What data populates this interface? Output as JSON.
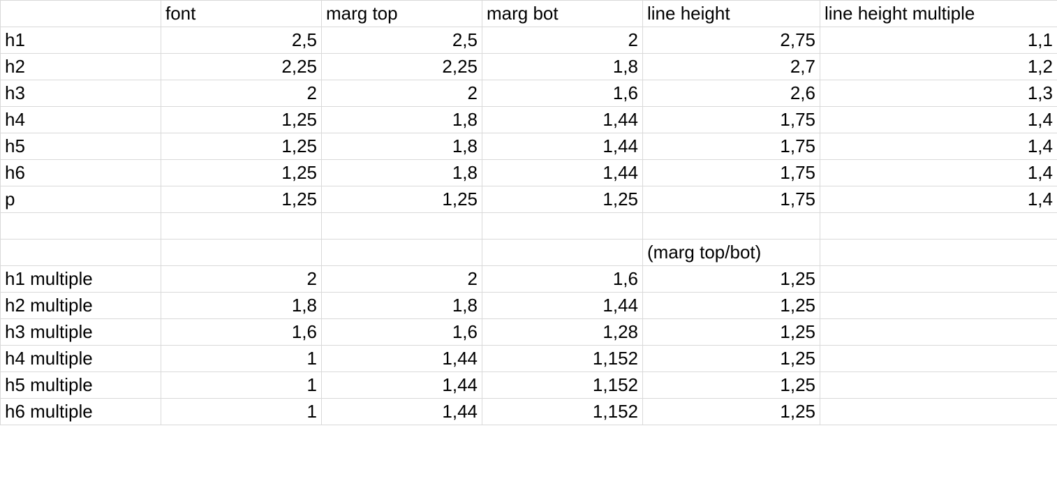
{
  "chart_data": {
    "type": "table",
    "columns": [
      "",
      "font",
      "marg top",
      "marg bot",
      "line height",
      "line height multiple"
    ],
    "rows": [
      [
        "h1",
        "2,5",
        "2,5",
        "2",
        "2,75",
        "1,1"
      ],
      [
        "h2",
        "2,25",
        "2,25",
        "1,8",
        "2,7",
        "1,2"
      ],
      [
        "h3",
        "2",
        "2",
        "1,6",
        "2,6",
        "1,3"
      ],
      [
        "h4",
        "1,25",
        "1,8",
        "1,44",
        "1,75",
        "1,4"
      ],
      [
        "h5",
        "1,25",
        "1,8",
        "1,44",
        "1,75",
        "1,4"
      ],
      [
        "h6",
        "1,25",
        "1,8",
        "1,44",
        "1,75",
        "1,4"
      ],
      [
        "p",
        "1,25",
        "1,25",
        "1,25",
        "1,75",
        "1,4"
      ],
      [
        "",
        "",
        "",
        "",
        "",
        ""
      ],
      [
        "",
        "",
        "",
        "",
        "(marg top/bot)",
        ""
      ],
      [
        "h1 multiple",
        "2",
        "2",
        "1,6",
        "1,25",
        ""
      ],
      [
        "h2 multiple",
        "1,8",
        "1,8",
        "1,44",
        "1,25",
        ""
      ],
      [
        "h3 multiple",
        "1,6",
        "1,6",
        "1,28",
        "1,25",
        ""
      ],
      [
        "h4 multiple",
        "1",
        "1,44",
        "1,152",
        "1,25",
        ""
      ],
      [
        "h5 multiple",
        "1",
        "1,44",
        "1,152",
        "1,25",
        ""
      ],
      [
        "h6 multiple",
        "1",
        "1,44",
        "1,152",
        "1,25",
        ""
      ]
    ]
  },
  "headers": {
    "c0": "",
    "c1": "font",
    "c2": "marg top",
    "c3": "marg bot",
    "c4": "line height",
    "c5": "line height multiple"
  },
  "rows": {
    "r0": {
      "label": "h1",
      "font": "2,5",
      "mtop": "2,5",
      "mbot": "2",
      "lh": "2,75",
      "lhm": "1,1"
    },
    "r1": {
      "label": "h2",
      "font": "2,25",
      "mtop": "2,25",
      "mbot": "1,8",
      "lh": "2,7",
      "lhm": "1,2"
    },
    "r2": {
      "label": "h3",
      "font": "2",
      "mtop": "2",
      "mbot": "1,6",
      "lh": "2,6",
      "lhm": "1,3"
    },
    "r3": {
      "label": "h4",
      "font": "1,25",
      "mtop": "1,8",
      "mbot": "1,44",
      "lh": "1,75",
      "lhm": "1,4"
    },
    "r4": {
      "label": "h5",
      "font": "1,25",
      "mtop": "1,8",
      "mbot": "1,44",
      "lh": "1,75",
      "lhm": "1,4"
    },
    "r5": {
      "label": "h6",
      "font": "1,25",
      "mtop": "1,8",
      "mbot": "1,44",
      "lh": "1,75",
      "lhm": "1,4"
    },
    "r6": {
      "label": "p",
      "font": "1,25",
      "mtop": "1,25",
      "mbot": "1,25",
      "lh": "1,75",
      "lhm": "1,4"
    }
  },
  "note": {
    "text": "(marg top/bot)"
  },
  "mrows": {
    "m0": {
      "label": "h1 multiple",
      "font": "2",
      "mtop": "2",
      "mbot": "1,6",
      "ratio": "1,25"
    },
    "m1": {
      "label": "h2 multiple",
      "font": "1,8",
      "mtop": "1,8",
      "mbot": "1,44",
      "ratio": "1,25"
    },
    "m2": {
      "label": "h3 multiple",
      "font": "1,6",
      "mtop": "1,6",
      "mbot": "1,28",
      "ratio": "1,25"
    },
    "m3": {
      "label": "h4 multiple",
      "font": "1",
      "mtop": "1,44",
      "mbot": "1,152",
      "ratio": "1,25"
    },
    "m4": {
      "label": "h5 multiple",
      "font": "1",
      "mtop": "1,44",
      "mbot": "1,152",
      "ratio": "1,25"
    },
    "m5": {
      "label": "h6 multiple",
      "font": "1",
      "mtop": "1,44",
      "mbot": "1,152",
      "ratio": "1,25"
    }
  }
}
